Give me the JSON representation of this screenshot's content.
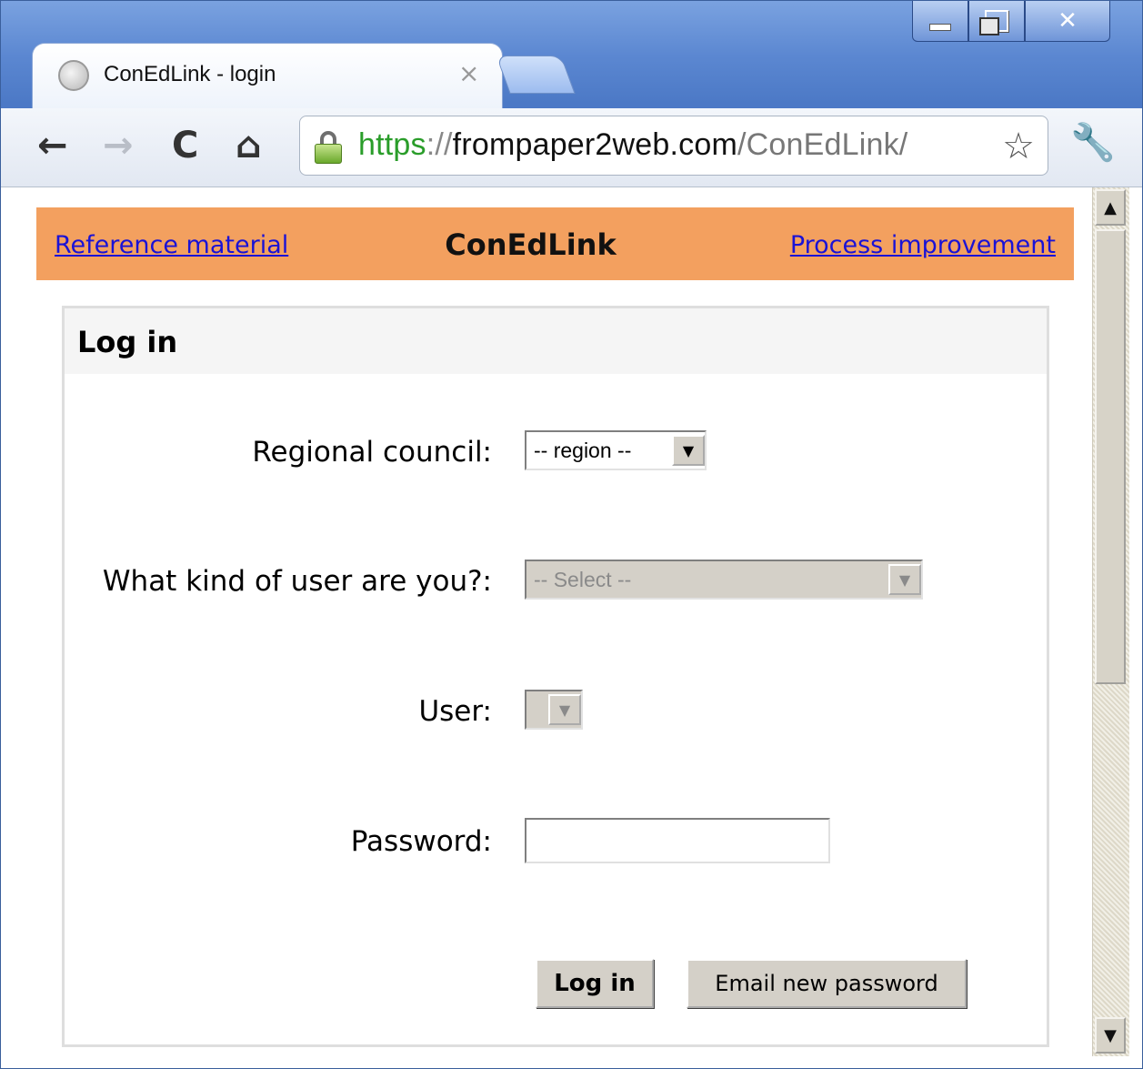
{
  "browser": {
    "tab_title": "ConEdLink - login",
    "tab_close": "×",
    "url": {
      "scheme": "https",
      "sep": "://",
      "host": "frompaper2web.com",
      "path": "/ConEdLink/"
    },
    "icons": {
      "back": "back-arrow-icon",
      "forward": "forward-arrow-icon",
      "reload": "reload-icon",
      "home": "home-icon",
      "lock": "lock-icon",
      "star": "star-icon",
      "wrench": "wrench-icon",
      "favicon": "globe-icon"
    },
    "window_controls": [
      "minimize",
      "maximize",
      "close"
    ]
  },
  "banner": {
    "left_link": "Reference material",
    "brand": "ConEdLink",
    "right_link": "Process improvement",
    "background": "#f3a05f",
    "link_color": "#1a12d6"
  },
  "login": {
    "title": "Log in",
    "fields": {
      "region_label": "Regional council:",
      "region_value": "-- region --",
      "user_type_label": "What kind of user are you?:",
      "user_type_value": "-- Select --",
      "user_label": "User:",
      "user_value": "",
      "password_label": "Password:",
      "password_value": ""
    },
    "buttons": {
      "login": "Log in",
      "email_password": "Email new password"
    }
  }
}
